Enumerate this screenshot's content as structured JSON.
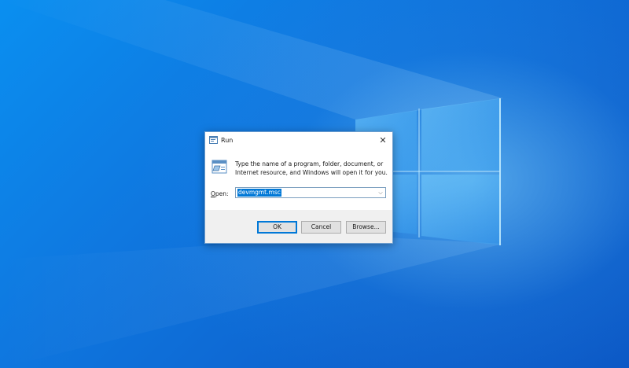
{
  "desktop": {
    "background_colors": [
      "#0a8ff0",
      "#0d63cf",
      "#8fdcff"
    ]
  },
  "dialog": {
    "title": "Run",
    "close_label": "✕",
    "description": "Type the name of a program, folder, document, or Internet resource, and Windows will open it for you.",
    "open_label_access": "O",
    "open_label_rest": "pen:",
    "open_value": "devmgmt.msc",
    "dropdown_arrow": "⌵",
    "buttons": {
      "ok": "OK",
      "cancel": "Cancel",
      "browse": "Browse..."
    },
    "accent_color": "#0078d7"
  }
}
